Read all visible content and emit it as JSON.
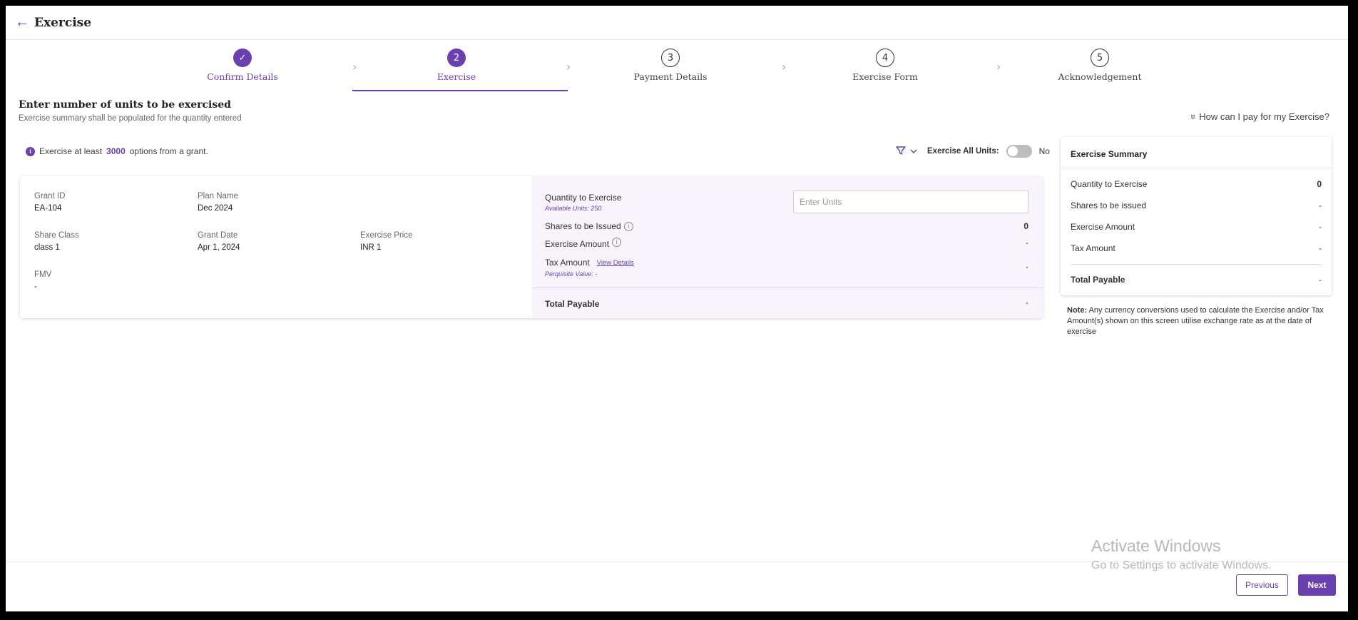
{
  "header": {
    "back_icon": "arrow-left-icon",
    "title": "Exercise"
  },
  "stepper": {
    "steps": [
      {
        "number": "",
        "label": "Confirm Details",
        "status": "done"
      },
      {
        "number": "2",
        "label": "Exercise",
        "status": "active"
      },
      {
        "number": "3",
        "label": "Payment Details",
        "status": "pending"
      },
      {
        "number": "4",
        "label": "Exercise Form",
        "status": "pending"
      },
      {
        "number": "5",
        "label": "Acknowledgement",
        "status": "pending"
      }
    ],
    "check_icon": "✓",
    "chevron_icon": "›"
  },
  "section": {
    "title": "Enter number of units to be exercised",
    "subtitle": "Exercise summary shall be populated for the quantity entered",
    "help_link": "How can I pay for my Exercise?",
    "help_icon": "»"
  },
  "info": {
    "icon": "i",
    "prefix": "Exercise at least",
    "min_options": "3000",
    "suffix": "options from a grant."
  },
  "controls": {
    "filter_icon": "⏷",
    "filter_chevron": "⌄",
    "exercise_all_label": "Exercise All Units:",
    "exercise_all_value": "No"
  },
  "grant": {
    "grant_id_label": "Grant ID",
    "grant_id": "EA-104",
    "plan_name_label": "Plan Name",
    "plan_name": "Dec 2024",
    "share_class_label": "Share Class",
    "share_class": "class 1",
    "grant_date_label": "Grant Date",
    "grant_date": "Apr 1, 2024",
    "exercise_price_label": "Exercise Price",
    "exercise_price": "INR 1",
    "fmv_label": "FMV",
    "fmv": "-"
  },
  "calc": {
    "quantity_label": "Quantity to Exercise",
    "available_units": "Available Units: 250",
    "input_placeholder": "Enter Units",
    "input_value": "",
    "shares_label": "Shares to be Issued",
    "shares_value": "0",
    "exercise_amount_label": "Exercise Amount",
    "exercise_amount_value": "-",
    "tax_amount_label": "Tax Amount",
    "view_details": "View Details",
    "perquisite": "Perquisite Value: -",
    "tax_amount_value": "-",
    "total_label": "Total Payable",
    "total_value": "-",
    "help_icon": "i"
  },
  "summary": {
    "title": "Exercise Summary",
    "rows": [
      {
        "label": "Quantity to Exercise",
        "value": "0"
      },
      {
        "label": "Shares to be issued",
        "value": "-"
      },
      {
        "label": "Exercise Amount",
        "value": "-"
      },
      {
        "label": "Tax Amount",
        "value": "-"
      }
    ],
    "total_label": "Total Payable",
    "total_value": "-"
  },
  "note": {
    "label": "Note:",
    "text": "Any currency conversions used to calculate the Exercise and/or Tax Amount(s) shown on this screen utilise exchange rate as at the date of exercise"
  },
  "watermark": {
    "line1": "Activate Windows",
    "line2": "Go to Settings to activate Windows."
  },
  "footer": {
    "previous": "Previous",
    "next": "Next"
  }
}
